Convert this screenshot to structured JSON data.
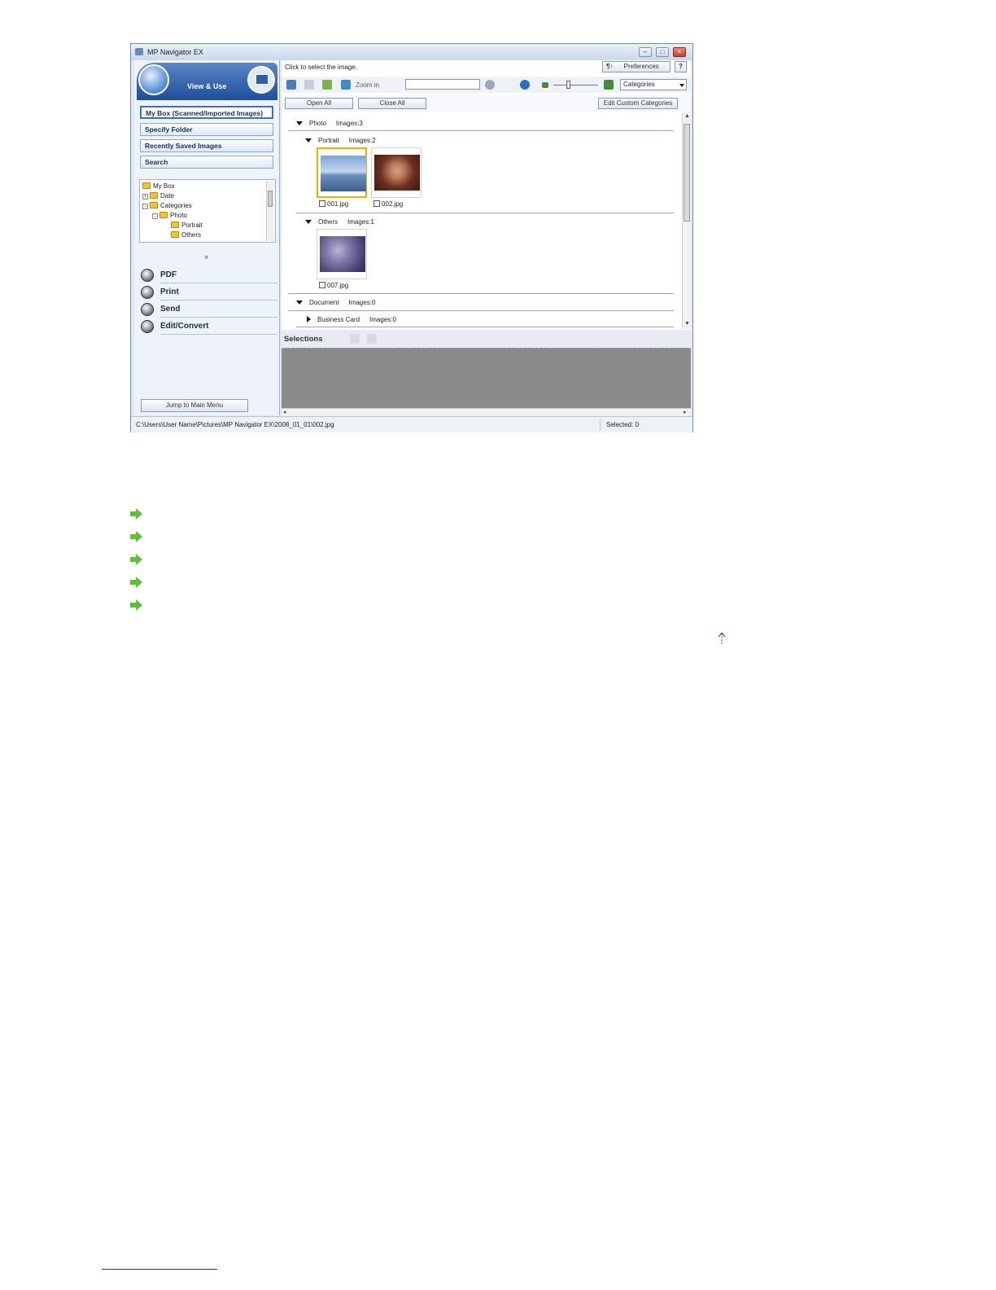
{
  "window": {
    "title": "MP Navigator EX"
  },
  "left": {
    "mode_label": "View & Use",
    "nav": [
      {
        "label": "My Box (Scanned/Imported Images)"
      },
      {
        "label": "Specify Folder"
      },
      {
        "label": "Recently Saved Images"
      },
      {
        "label": "Search"
      }
    ],
    "tree": {
      "my_box": "My Box",
      "date": "Date",
      "categories": "Categories",
      "photo": "Photo",
      "portrait": "Portrait",
      "others": "Others"
    },
    "expand_glyph": "»",
    "actions": [
      {
        "label": "PDF",
        "icon": "pdf-icon"
      },
      {
        "label": "Print",
        "icon": "print-icon"
      },
      {
        "label": "Send",
        "icon": "send-icon"
      },
      {
        "label": "Edit/Convert",
        "icon": "edit-convert-icon"
      }
    ],
    "jump_label": "Jump to Main Menu"
  },
  "right": {
    "hint": "Click to select the image.",
    "preferences_label": "Preferences",
    "help_label": "?",
    "toolbar": {
      "zoom_label": "Zoom in",
      "search_value": "",
      "view_select": "Categories"
    },
    "open_all_label": "Open All",
    "close_all_label": "Close All",
    "edit_categories_label": "Edit Custom Categories",
    "groups": {
      "photo": {
        "name": "Photo",
        "count": "Images:3"
      },
      "portrait": {
        "name": "Portrait",
        "count": "Images:2"
      },
      "others": {
        "name": "Others",
        "count": "Images:1"
      },
      "document": {
        "name": "Document",
        "count": "Images:0"
      },
      "business_card": {
        "name": "Business Card",
        "count": "Images:0"
      }
    },
    "images": {
      "img1": {
        "name": "001.jpg",
        "selected": true
      },
      "img2": {
        "name": "002.jpg",
        "selected": false
      },
      "img3": {
        "name": "007.jpg",
        "selected": false
      }
    },
    "selections_label": "Selections"
  },
  "status": {
    "path": "C:\\Users\\User Name\\Pictures\\MP Navigator EX\\2008_01_01\\002.jpg",
    "selected": "Selected: 0"
  },
  "colors": {
    "selection_border": "#f0b000",
    "link_arrow": "#5cbf3a",
    "banner": "#1f4e9a"
  }
}
